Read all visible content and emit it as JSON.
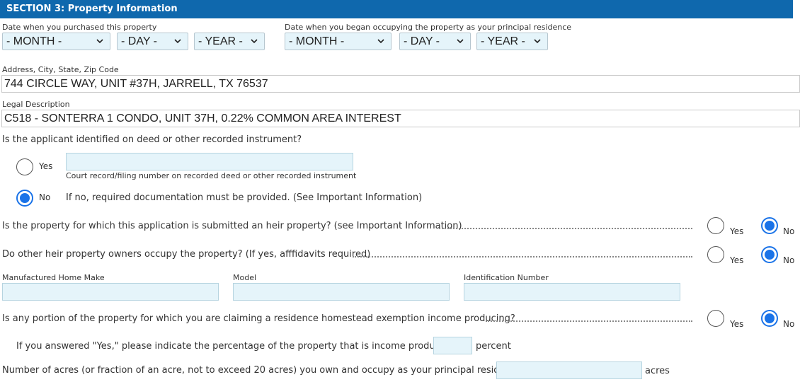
{
  "section": {
    "title": "SECTION 3: Property Information"
  },
  "purchase": {
    "label": "Date when you purchased this property",
    "month": "- MONTH -",
    "day": "- DAY -",
    "year": "- YEAR -"
  },
  "occupancy": {
    "label": "Date when you began occupying the property as your principal residence",
    "month": "- MONTH -",
    "day": "- DAY -",
    "year": "- YEAR -"
  },
  "address": {
    "label": "Address, City, State, Zip Code",
    "value": "744 CIRCLE WAY, UNIT #37H, JARRELL, TX  76537"
  },
  "legal": {
    "label": "Legal Description",
    "value": "C518 - SONTERRA 1 CONDO, UNIT 37H, 0.22% COMMON AREA INTEREST"
  },
  "deed": {
    "question": "Is the applicant identified on deed or other recorded instrument?",
    "yes_label": "Yes",
    "no_label": "No",
    "selected": "No",
    "court_record_caption": "Court record/filing number on recorded deed or other recorded instrument",
    "court_record_value": "",
    "no_note": "If no, required documentation must be provided. (See Important Information)"
  },
  "heir_property": {
    "question": "Is the property for which this application is submitted an heir property? (see Important Information)",
    "yes_label": "Yes",
    "no_label": "No",
    "selected": "No"
  },
  "heir_owners": {
    "question": "Do other heir property owners occupy the property? (If yes, afffidavits required)",
    "yes_label": "Yes",
    "no_label": "No",
    "selected": "No"
  },
  "manufactured_home": {
    "make_label": "Manufactured Home Make",
    "model_label": "Model",
    "id_label": "Identification Number",
    "make_value": "",
    "model_value": "",
    "id_value": ""
  },
  "income_producing": {
    "question": "Is any portion of the property for which you are claiming a residence homestead exemption income producing?",
    "yes_label": "Yes",
    "no_label": "No",
    "selected": "No",
    "percent_prompt": "If you answered \"Yes,\" please indicate the percentage of the property that is income producing:",
    "percent_value": "",
    "percent_unit": "percent"
  },
  "acres": {
    "question": "Number of acres (or fraction of an acre, not to exceed 20 acres) you own and occupy as your principal residence:",
    "value": "",
    "unit": "acres"
  },
  "colors": {
    "section_bar": "#0f68ad",
    "input_fill": "#e5f4fa",
    "radio_selected": "#1a73e8"
  }
}
